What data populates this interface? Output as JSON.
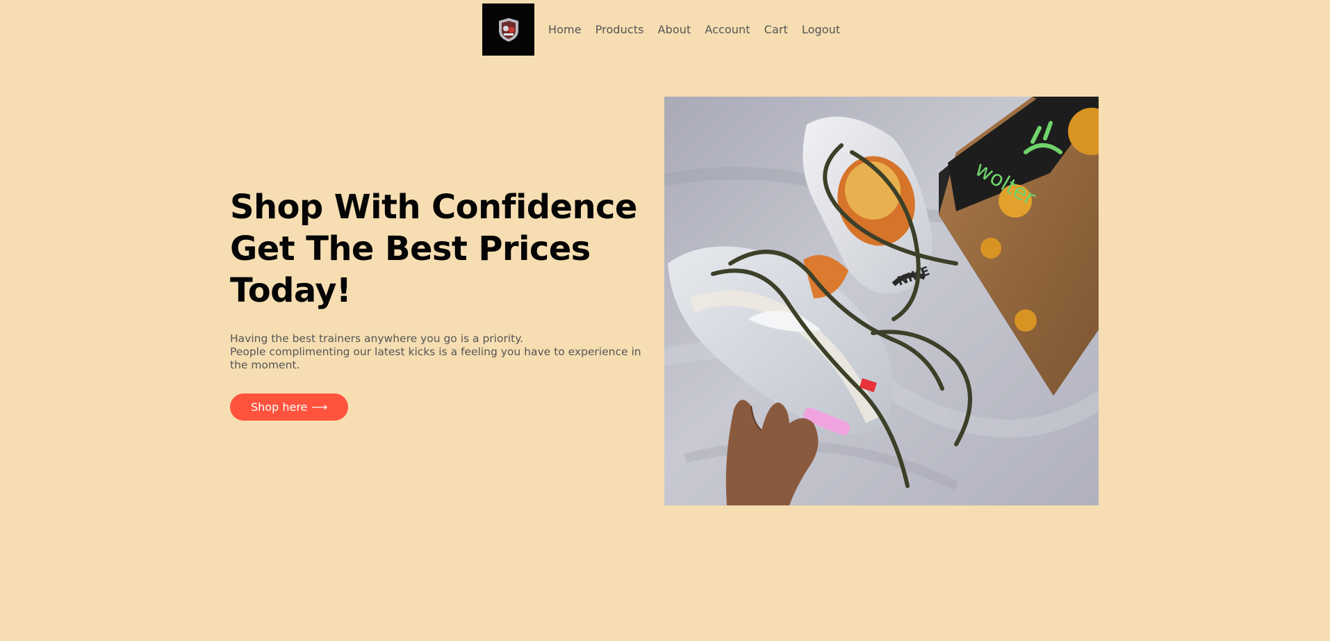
{
  "nav": {
    "logo_icon": "brand-crest-logo",
    "links": [
      "Home",
      "Products",
      "About",
      "Account",
      "Cart",
      "Logout"
    ]
  },
  "hero": {
    "title_lines": [
      "Shop With Confidence",
      "Get The Best Prices",
      "Today!"
    ],
    "text_lines": [
      "Having the best trainers anywhere you go is a priority.",
      "People complimenting our latest kicks is a feeling you have to experience in the moment."
    ],
    "cta_label": "Shop here",
    "cta_icon": "arrow-right-icon",
    "image_icon": "sneakers-photo"
  },
  "colors": {
    "background": "#f6deb2",
    "cta": "#ff533d",
    "title": "#050505",
    "text": "#555555"
  }
}
